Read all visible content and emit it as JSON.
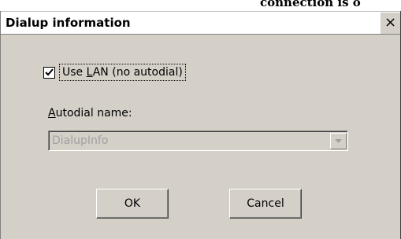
{
  "background": {
    "partial_text": "connection is o"
  },
  "dialog": {
    "title": "Dialup information",
    "close_glyph": "×",
    "use_lan": {
      "label_prefix": "Use ",
      "label_access": "L",
      "label_suffix": "AN (no autodial)",
      "checked": true
    },
    "autodial": {
      "label_access": "A",
      "label_suffix": "utodial name:",
      "value": "DialupInfo",
      "disabled": true
    },
    "buttons": {
      "ok": "OK",
      "cancel": "Cancel"
    }
  },
  "colors": {
    "face": "#d4d0c8",
    "disabled_text": "#a0a0a0",
    "title_bg": "#ffffff"
  }
}
